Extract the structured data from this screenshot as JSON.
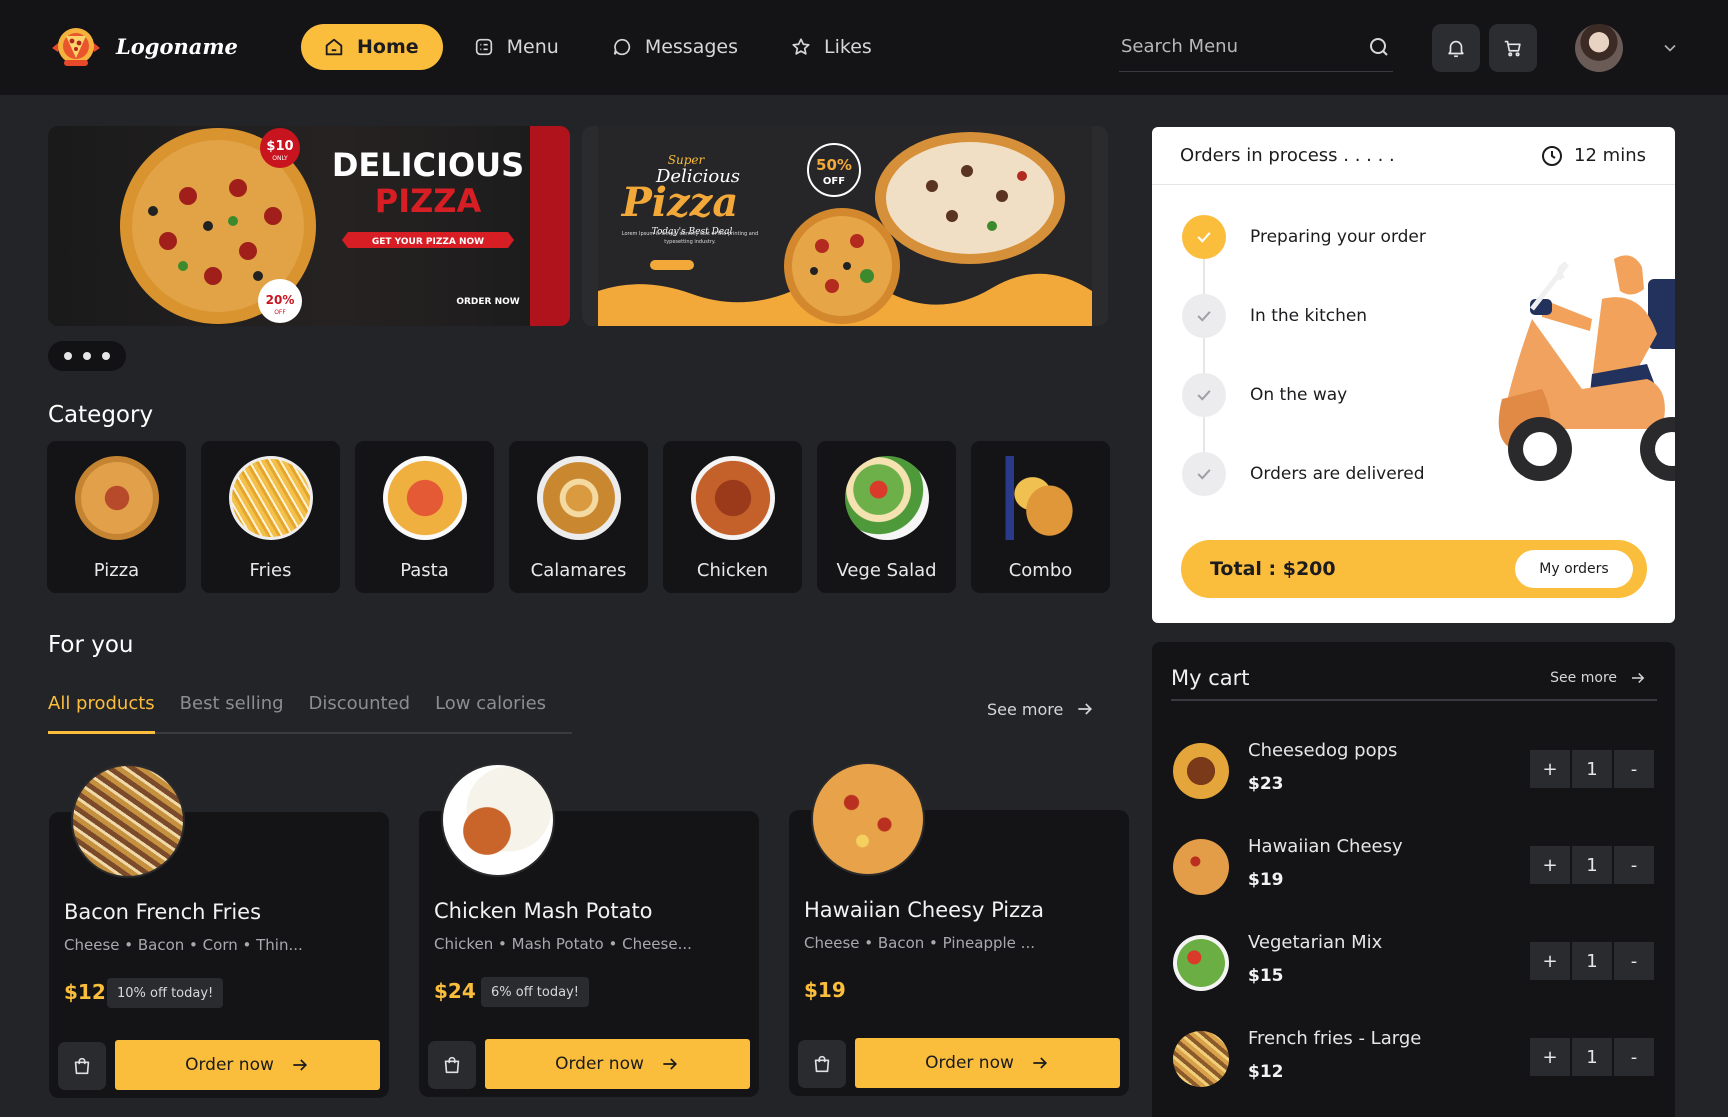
{
  "header": {
    "logo_text": "Logoname",
    "nav": [
      {
        "label": "Home",
        "icon": "home-icon",
        "active": true
      },
      {
        "label": "Menu",
        "icon": "menu-icon",
        "active": false
      },
      {
        "label": "Messages",
        "icon": "chat-icon",
        "active": false
      },
      {
        "label": "Likes",
        "icon": "star-icon",
        "active": false
      }
    ],
    "search_placeholder": "Search Menu"
  },
  "banners": [
    {
      "title": "DELICIOUS PIZZA",
      "line1": "DELICIOUS",
      "line2": "PIZZA",
      "cta": "GET YOUR PIZZA NOW",
      "price_tag": "$10",
      "price_sub": "ONLY",
      "discount": "20%",
      "discount_sub": "OFF",
      "order": "ORDER NOW"
    },
    {
      "line1": "Super",
      "line2": "Delicious",
      "line3": "Pizza",
      "line4": "Today's Best Deal",
      "discount": "50%",
      "discount_sub": "OFF",
      "body": "Lorem Ipsum is simply dummy text of the printing and typesetting industry."
    }
  ],
  "category": {
    "title": "Category",
    "items": [
      "Pizza",
      "Fries",
      "Pasta",
      "Calamares",
      "Chicken",
      "Vege Salad",
      "Combo"
    ]
  },
  "for_you": {
    "title": "For you",
    "tabs": [
      {
        "label": "All products",
        "active": true
      },
      {
        "label": "Best selling",
        "active": false
      },
      {
        "label": "Discounted",
        "active": false
      },
      {
        "label": "Low calories",
        "active": false
      }
    ],
    "see_more": "See more",
    "order_label": "Order now",
    "products": [
      {
        "name": "Bacon French Fries",
        "desc": "Cheese • Bacon • Corn • Thin...",
        "price": "$12",
        "badge": "10% off today!"
      },
      {
        "name": "Chicken Mash Potato",
        "desc": "Chicken • Mash Potato • Cheese...",
        "price": "$24",
        "badge": "6% off today!"
      },
      {
        "name": "Hawaiian Cheesy Pizza",
        "desc": "Cheese • Bacon • Pineapple ...",
        "price": "$19",
        "badge": ""
      }
    ]
  },
  "orders": {
    "title": "Orders in process . . . . .",
    "time": "12 mins",
    "steps": [
      {
        "label": "Preparing your order",
        "done": true
      },
      {
        "label": "In the kitchen",
        "done": false
      },
      {
        "label": "On the way",
        "done": false
      },
      {
        "label": "Orders are delivered",
        "done": false
      }
    ],
    "total": "Total : $200",
    "my_orders": "My orders"
  },
  "cart": {
    "title": "My cart",
    "see_more": "See more",
    "items": [
      {
        "name": "Cheesedog pops",
        "price": "$23",
        "qty": "1"
      },
      {
        "name": "Hawaiian Cheesy",
        "price": "$19",
        "qty": "1"
      },
      {
        "name": "Vegetarian Mix",
        "price": "$15",
        "qty": "1"
      },
      {
        "name": "French fries - Large",
        "price": "$12",
        "qty": "1"
      }
    ],
    "plus": "+",
    "minus": "-"
  },
  "colors": {
    "accent": "#fbbd3c",
    "bg": "#232427",
    "panel": "#141416"
  }
}
